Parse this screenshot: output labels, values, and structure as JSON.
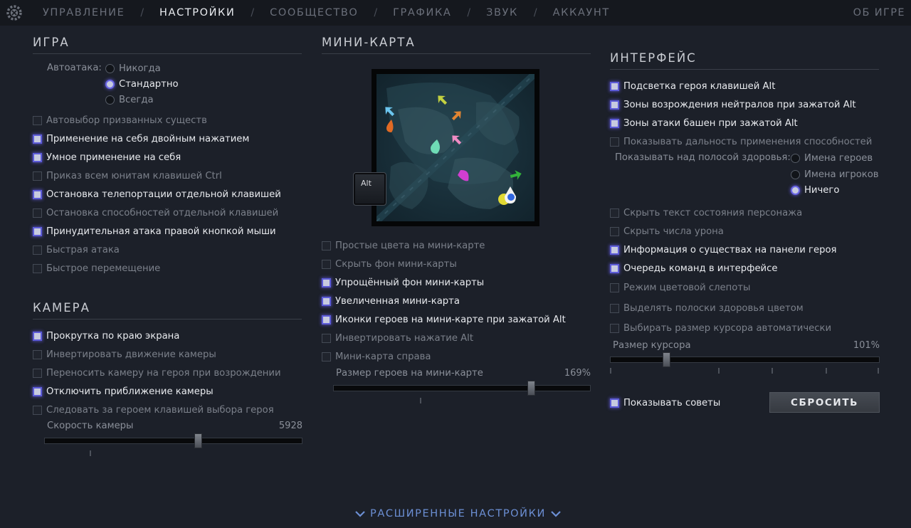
{
  "nav": {
    "items": [
      "УПРАВЛЕНИЕ",
      "НАСТРОЙКИ",
      "СООБЩЕСТВО",
      "ГРАФИКА",
      "ЗВУК",
      "АККАУНТ"
    ],
    "active": "НАСТРОЙКИ",
    "about": "ОБ ИГРЕ"
  },
  "game": {
    "title": "ИГРА",
    "autoattack_label": "Автоатака:",
    "autoattack_options": [
      {
        "label": "Никогда",
        "selected": false
      },
      {
        "label": "Стандартно",
        "selected": true
      },
      {
        "label": "Всегда",
        "selected": false
      }
    ],
    "options": [
      {
        "label": "Автовыбор призванных существ",
        "checked": false
      },
      {
        "label": "Применение на себя двойным нажатием",
        "checked": true
      },
      {
        "label": "Умное применение на себя",
        "checked": true
      },
      {
        "label": "Приказ всем юнитам клавишей Ctrl",
        "checked": false
      },
      {
        "label": "Остановка телепортации отдельной клавишей",
        "checked": true
      },
      {
        "label": "Остановка способностей отдельной клавишей",
        "checked": false
      },
      {
        "label": "Принудительная атака правой кнопкой мыши",
        "checked": true
      },
      {
        "label": "Быстрая атака",
        "checked": false
      },
      {
        "label": "Быстрое перемещение",
        "checked": false
      }
    ]
  },
  "camera": {
    "title": "КАМЕРА",
    "options": [
      {
        "label": "Прокрутка по краю экрана",
        "checked": true
      },
      {
        "label": "Инвертировать движение камеры",
        "checked": false
      },
      {
        "label": "Переносить камеру на героя при возрождении",
        "checked": false
      },
      {
        "label": "Отключить приближение камеры",
        "checked": true
      },
      {
        "label": "Следовать за героем клавишей выбора героя",
        "checked": false
      }
    ],
    "speed_label": "Скорость камеры",
    "speed_value": "5928",
    "speed_fraction": 0.6
  },
  "minimap": {
    "title": "МИНИ-КАРТА",
    "alt_key": "Alt",
    "options": [
      {
        "label": "Простые цвета на мини-карте",
        "checked": false
      },
      {
        "label": "Скрыть фон мини-карты",
        "checked": false
      },
      {
        "label": "Упрощённый фон мини-карты",
        "checked": true
      },
      {
        "label": "Увеличенная мини-карта",
        "checked": true
      },
      {
        "label": "Иконки героев на мини-карте при зажатой Alt",
        "checked": true
      },
      {
        "label": "Инвертировать нажатие Alt",
        "checked": false
      },
      {
        "label": "Мини-карта справа",
        "checked": false
      }
    ],
    "hero_size_label": "Размер героев на мини-карте",
    "hero_size_value": "169%",
    "hero_size_fraction": 0.78
  },
  "interface": {
    "title": "ИНТЕРФЕЙС",
    "options_top": [
      {
        "label": "Подсветка героя клавишей Alt",
        "checked": true
      },
      {
        "label": "Зоны возрождения нейтралов при зажатой Alt",
        "checked": true
      },
      {
        "label": "Зоны атаки башен при зажатой Alt",
        "checked": true
      },
      {
        "label": "Показывать дальность применения способностей",
        "checked": false
      }
    ],
    "healthbar_label": "Показывать над полосой здоровья:",
    "healthbar_options": [
      {
        "label": "Имена героев",
        "selected": false
      },
      {
        "label": "Имена игроков",
        "selected": false
      },
      {
        "label": "Ничего",
        "selected": true
      }
    ],
    "options_bottom": [
      {
        "label": "Скрыть текст состояния персонажа",
        "checked": false
      },
      {
        "label": "Скрыть числа урона",
        "checked": false
      },
      {
        "label": "Информация о существах на панели героя",
        "checked": true
      },
      {
        "label": "Очередь команд в интерфейсе",
        "checked": true
      },
      {
        "label": "Режим цветовой слепоты",
        "checked": false
      },
      {
        "label": "Выделять полоски здоровья цветом",
        "checked": false
      },
      {
        "label": "Выбирать размер курсора автоматически",
        "checked": false
      }
    ],
    "cursor_label": "Размер курсора",
    "cursor_value": "101%",
    "cursor_fraction": 0.2,
    "tips_label": "Показывать советы",
    "tips_checked": true,
    "reset_label": "СБРОСИТЬ"
  },
  "advanced_label": "РАСШИРЕННЫЕ НАСТРОЙКИ",
  "colors": {
    "accent": "#5d5cd8",
    "background": "#1c2029",
    "link": "#6c8fd4"
  }
}
